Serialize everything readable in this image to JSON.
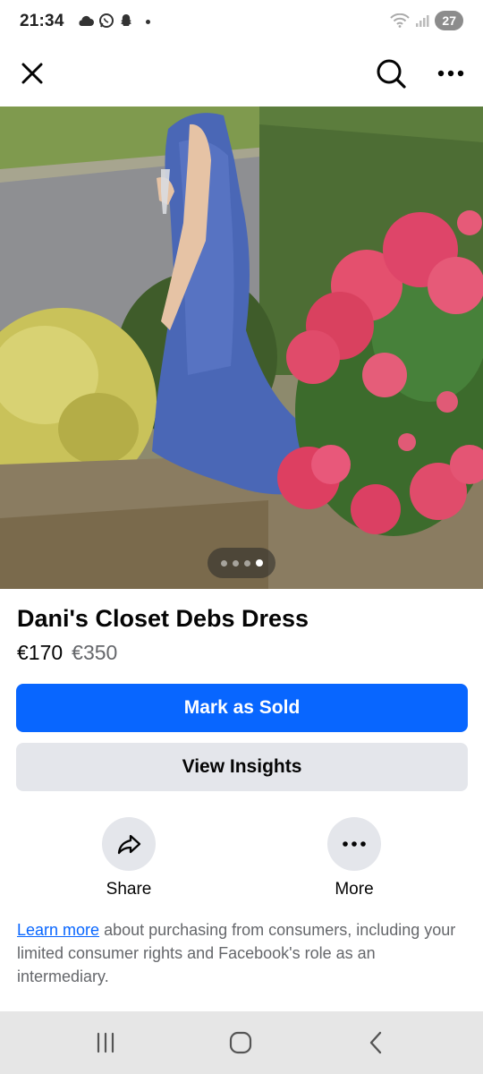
{
  "status_bar": {
    "time": "21:34",
    "battery": "27"
  },
  "top_nav": {
    "close_icon": "close-icon",
    "search_icon": "search-icon",
    "more_icon": "more-horizontal-icon"
  },
  "photo": {
    "pager": {
      "total": 4,
      "active_index": 3
    }
  },
  "listing": {
    "title": "Dani's Closet Debs Dress",
    "price": "€170",
    "original_price": "€350"
  },
  "buttons": {
    "mark_sold": "Mark as Sold",
    "view_insights": "View Insights"
  },
  "actions": {
    "share_label": "Share",
    "more_label": "More"
  },
  "disclaimer": {
    "link": "Learn more",
    "text": " about purchasing from consumers, including your limited consumer rights and Facebook's role as an intermediary."
  },
  "colors": {
    "primary": "#0866ff",
    "secondary_bg": "#e4e6eb",
    "muted_text": "#65676b"
  }
}
